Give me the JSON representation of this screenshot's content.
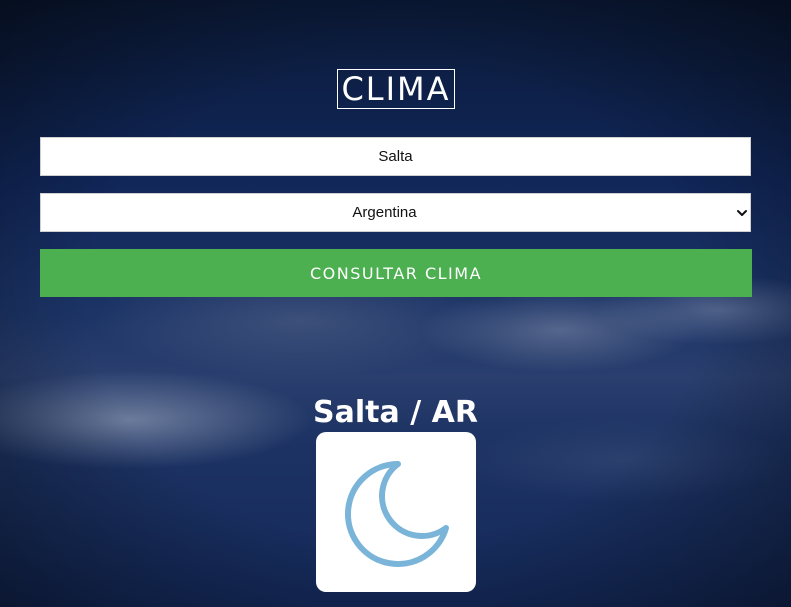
{
  "app": {
    "title": "CLIMA"
  },
  "form": {
    "city_input": {
      "value": "Salta",
      "placeholder": ""
    },
    "country_select": {
      "selected": "Argentina"
    },
    "submit_label": "CONSULTAR CLIMA"
  },
  "result": {
    "heading": "Salta / AR",
    "icon": "moon-icon"
  },
  "colors": {
    "button": "#4caf50",
    "moon_stroke": "#7ab4d8",
    "text": "#ffffff",
    "card": "#ffffff"
  }
}
